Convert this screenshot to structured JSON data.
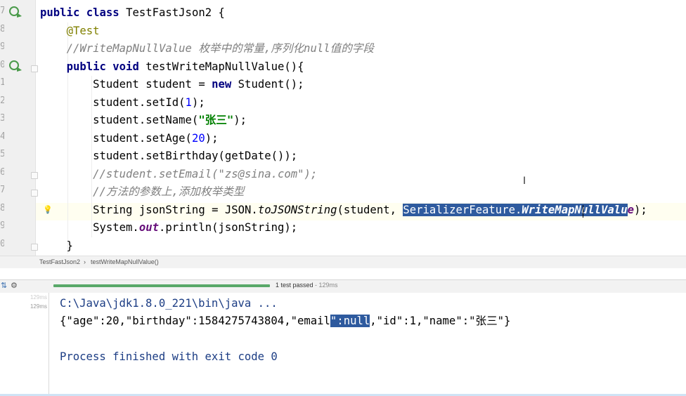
{
  "editor": {
    "line_numbers": [
      "7",
      "8",
      "9",
      "0",
      "1",
      "2",
      "3",
      "4",
      "5",
      "6",
      "7",
      "8",
      "9",
      "0"
    ],
    "lines": [
      {
        "tokens": [
          {
            "t": "public ",
            "c": "kw"
          },
          {
            "t": "class ",
            "c": "kw"
          },
          {
            "t": "TestFastJson2 {",
            "c": ""
          }
        ]
      },
      {
        "tokens": [
          {
            "t": "    ",
            "c": ""
          },
          {
            "t": "@Test",
            "c": "ann"
          }
        ]
      },
      {
        "tokens": [
          {
            "t": "    ",
            "c": ""
          },
          {
            "t": "//WriteMapNullValue 枚举中的常量,序列化null值的字段",
            "c": "cmt"
          }
        ]
      },
      {
        "tokens": [
          {
            "t": "    ",
            "c": ""
          },
          {
            "t": "public ",
            "c": "kw"
          },
          {
            "t": "void ",
            "c": "kw"
          },
          {
            "t": "testWriteMapNullValue(){",
            "c": ""
          }
        ]
      },
      {
        "tokens": [
          {
            "t": "        Student student = ",
            "c": ""
          },
          {
            "t": "new ",
            "c": "kw"
          },
          {
            "t": "Student();",
            "c": ""
          }
        ]
      },
      {
        "tokens": [
          {
            "t": "        student.setId(",
            "c": ""
          },
          {
            "t": "1",
            "c": "num"
          },
          {
            "t": ");",
            "c": ""
          }
        ]
      },
      {
        "tokens": [
          {
            "t": "        student.setName(",
            "c": ""
          },
          {
            "t": "\"张三\"",
            "c": "str"
          },
          {
            "t": ");",
            "c": ""
          }
        ]
      },
      {
        "tokens": [
          {
            "t": "        student.setAge(",
            "c": ""
          },
          {
            "t": "20",
            "c": "num"
          },
          {
            "t": ");",
            "c": ""
          }
        ]
      },
      {
        "tokens": [
          {
            "t": "        student.setBirthday(getDate());",
            "c": ""
          }
        ]
      },
      {
        "tokens": [
          {
            "t": "        ",
            "c": ""
          },
          {
            "t": "//student.setEmail(\"zs@sina.com\");",
            "c": "cmt"
          }
        ]
      },
      {
        "tokens": [
          {
            "t": "        ",
            "c": ""
          },
          {
            "t": "//方法的参数上,添加枚举类型",
            "c": "cmt"
          }
        ]
      },
      {
        "tokens": [
          {
            "t": "        String jsonString = JSON.",
            "c": ""
          },
          {
            "t": "toJSONString",
            "c": "italic"
          },
          {
            "t": "(student, ",
            "c": ""
          },
          {
            "t": "SerializerFeature.",
            "c": "sel"
          },
          {
            "t": "WriteMapNullValu",
            "c": "sel static-sel"
          },
          {
            "t": "e",
            "c": "static"
          },
          {
            "t": ");",
            "c": ""
          }
        ]
      },
      {
        "tokens": [
          {
            "t": "        System.",
            "c": ""
          },
          {
            "t": "out",
            "c": "static"
          },
          {
            "t": ".println(jsonString);",
            "c": ""
          }
        ]
      },
      {
        "tokens": [
          {
            "t": "    }",
            "c": ""
          }
        ]
      }
    ]
  },
  "breadcrumb": {
    "class_name": "TestFastJson2",
    "separator": "›",
    "method_name": "testWriteMapNullValue()"
  },
  "run_panel": {
    "test_status": "1 test passed",
    "test_time": " - 129ms",
    "tree_times": [
      "129ms",
      "129ms"
    ],
    "console": {
      "command": "C:\\Java\\jdk1.8.0_221\\bin\\java ...",
      "json_before": "{\"age\":20,\"birthday\":1584275743804,\"email",
      "json_selected": "\":null",
      "json_after": ",\"id\":1,\"name\":\"张三\"}",
      "exit_message": "Process finished with exit code 0"
    }
  },
  "colors": {
    "keyword": "#000080",
    "annotation": "#808000",
    "comment": "#808080",
    "number": "#0000ff",
    "string": "#008000",
    "selection": "#2e5a9e",
    "progress": "#59a869"
  }
}
